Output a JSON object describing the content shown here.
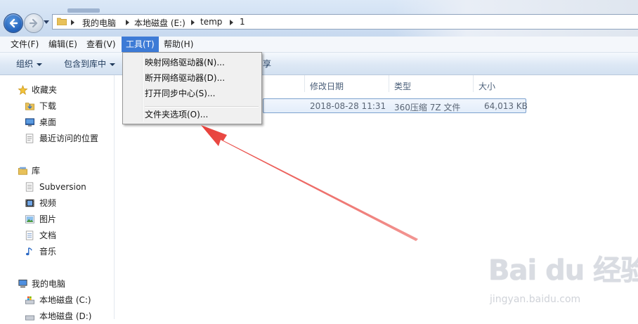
{
  "address": {
    "crumbs": [
      "我的电脑",
      "本地磁盘 (E:)",
      "temp",
      "1"
    ]
  },
  "menubar": {
    "items": [
      "文件(F)",
      "编辑(E)",
      "查看(V)",
      "工具(T)",
      "帮助(H)"
    ]
  },
  "toolbar": {
    "organize": "组织",
    "include_library": "包含到库中",
    "share_tail": "享"
  },
  "tools_menu": {
    "items": [
      "映射网络驱动器(N)...",
      "断开网络驱动器(D)...",
      "打开同步中心(S)...",
      "文件夹选项(O)..."
    ]
  },
  "nav": {
    "favorites": {
      "title": "收藏夹",
      "items": [
        "下载",
        "桌面",
        "最近访问的位置"
      ]
    },
    "libraries": {
      "title": "库",
      "items": [
        "Subversion",
        "视频",
        "图片",
        "文档",
        "音乐"
      ]
    },
    "computer": {
      "title": "我的电脑",
      "items": [
        "本地磁盘 (C:)",
        "本地磁盘 (D:)"
      ]
    }
  },
  "columns": {
    "modified": "修改日期",
    "type": "类型",
    "size": "大小"
  },
  "file": {
    "modified": "2018-08-28 11:31",
    "type": "360压缩 7Z 文件",
    "size": "64,013 KB"
  },
  "watermark": {
    "logo": "Bai du 经验",
    "url": "jingyan.baidu.com"
  },
  "colors": {
    "menu_highlight": "#3d7bd6",
    "arrow": "#e8413b",
    "toolbar_text": "#1e395b"
  }
}
